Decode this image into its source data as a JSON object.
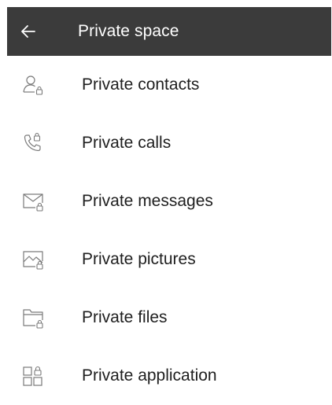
{
  "header": {
    "title": "Private space",
    "back_icon": "arrow-left-icon"
  },
  "items": [
    {
      "label": "Private contacts",
      "icon": "contact-lock-icon"
    },
    {
      "label": "Private calls",
      "icon": "phone-lock-icon"
    },
    {
      "label": "Private messages",
      "icon": "envelope-lock-icon"
    },
    {
      "label": "Private pictures",
      "icon": "picture-lock-icon"
    },
    {
      "label": "Private files",
      "icon": "folder-lock-icon"
    },
    {
      "label": "Private application",
      "icon": "apps-lock-icon"
    }
  ],
  "colors": {
    "header_bg": "#3b3b3b",
    "header_text": "#ffffff",
    "icon_stroke": "#7a7a7a",
    "text": "#1e1e1e"
  }
}
